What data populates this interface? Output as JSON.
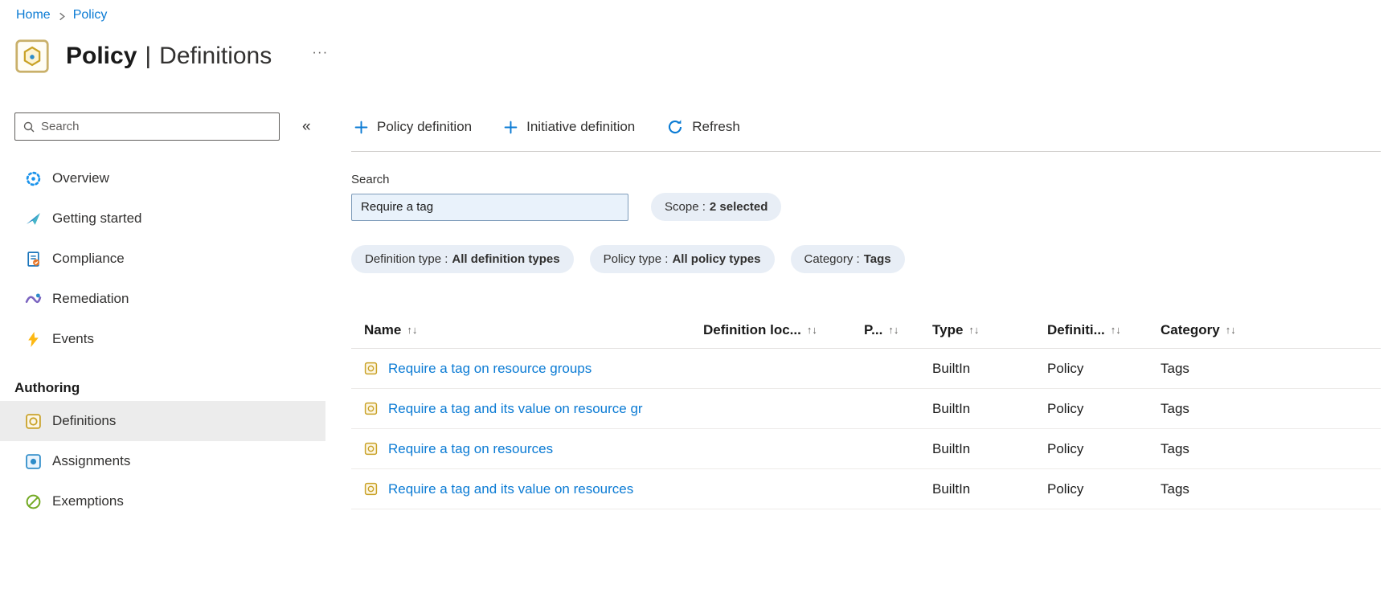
{
  "breadcrumb": {
    "home": "Home",
    "current": "Policy"
  },
  "header": {
    "title": "Policy",
    "separator": "|",
    "subtitle": "Definitions",
    "more": "···"
  },
  "sidebar": {
    "search": {
      "placeholder": "Search"
    },
    "collapse": "«",
    "items": [
      {
        "label": "Overview"
      },
      {
        "label": "Getting started"
      },
      {
        "label": "Compliance"
      },
      {
        "label": "Remediation"
      },
      {
        "label": "Events"
      }
    ],
    "section_title": "Authoring",
    "authoring": [
      {
        "label": "Definitions"
      },
      {
        "label": "Assignments"
      },
      {
        "label": "Exemptions"
      }
    ]
  },
  "toolbar": {
    "policy_definition": "Policy definition",
    "initiative_definition": "Initiative definition",
    "refresh": "Refresh"
  },
  "filters": {
    "search_label": "Search",
    "search_value": "Require a tag",
    "scope": {
      "label": "Scope :",
      "value": "2 selected"
    },
    "definition_type": {
      "label": "Definition type :",
      "value": "All definition types"
    },
    "policy_type": {
      "label": "Policy type :",
      "value": "All policy types"
    },
    "category": {
      "label": "Category :",
      "value": "Tags"
    }
  },
  "table": {
    "sort_icon": "↑↓",
    "columns": {
      "name": "Name",
      "definition_location": "Definition loc...",
      "policies": "P...",
      "type": "Type",
      "definition_type": "Definiti...",
      "category": "Category"
    },
    "rows": [
      {
        "name": "Require a tag on resource groups",
        "definition_location": "",
        "policies": "",
        "type": "BuiltIn",
        "definition_type": "Policy",
        "category": "Tags"
      },
      {
        "name": "Require a tag and its value on resource gr",
        "definition_location": "",
        "policies": "",
        "type": "BuiltIn",
        "definition_type": "Policy",
        "category": "Tags"
      },
      {
        "name": "Require a tag on resources",
        "definition_location": "",
        "policies": "",
        "type": "BuiltIn",
        "definition_type": "Policy",
        "category": "Tags"
      },
      {
        "name": "Require a tag and its value on resources",
        "definition_location": "",
        "policies": "",
        "type": "BuiltIn",
        "definition_type": "Policy",
        "category": "Tags"
      }
    ]
  }
}
